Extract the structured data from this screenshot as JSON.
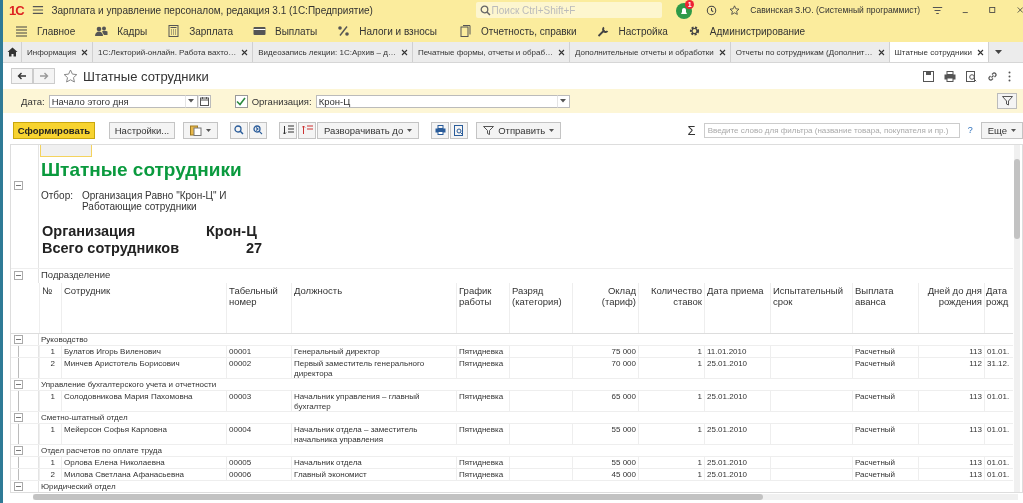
{
  "app": {
    "logo": "1С",
    "title": "Зарплата и управление персоналом, редакция 3.1  (1С:Предприятие)",
    "search": {
      "placeholder": "Поиск Ctrl+Shift+F"
    },
    "notifications": "1",
    "user": "Савинская З.Ю. (Системный программист)"
  },
  "sections": [
    {
      "label": "Главное",
      "kind": "list"
    },
    {
      "label": "Кадры",
      "kind": "people"
    },
    {
      "label": "Зарплата",
      "kind": "calculator"
    },
    {
      "label": "Выплаты",
      "kind": "card"
    },
    {
      "label": "Налоги и взносы",
      "kind": "percent"
    },
    {
      "label": "Отчетность, справки",
      "kind": "docs"
    },
    {
      "label": "Настройка",
      "kind": "wrench"
    },
    {
      "label": "Администрирование",
      "kind": "gear"
    }
  ],
  "tabs": [
    {
      "label": "Информация",
      "selected": false
    },
    {
      "label": "1С:Лекторий-онлайн. Работа вахто…",
      "selected": false
    },
    {
      "label": "Видеозапись лекции: 1С:Архив – д…",
      "selected": false
    },
    {
      "label": "Печатные формы, отчеты и обраб…",
      "selected": false
    },
    {
      "label": "Дополнительные отчеты и обработки",
      "selected": false
    },
    {
      "label": "Отчеты по сотрудникам (Дополнит…",
      "selected": false
    },
    {
      "label": "Штатные сотрудники",
      "selected": true
    }
  ],
  "form": {
    "title": "Штатные сотрудники"
  },
  "filters": {
    "date_label": "Дата:",
    "date_value": "Начало этого дня",
    "org_checked": true,
    "org_label": "Организация:",
    "org_value": "Крон-Ц"
  },
  "toolbar": {
    "generate": "Сформировать",
    "settings": "Настройки...",
    "expand": "Разворачивать до",
    "send": "Отправить",
    "sigma": "Σ",
    "filter_placeholder": "Введите слово для фильтра (название товара, покупателя и пр.)",
    "help": "?",
    "more": "Еще"
  },
  "report": {
    "title": "Штатные сотрудники",
    "filter_label": "Отбор:",
    "filter_text": "Организация Равно \"Крон-Ц\" И Работающие сотрудники",
    "summary": [
      {
        "label": "Организация",
        "value": "Крон-Ц"
      },
      {
        "label": "Всего сотрудников",
        "value": "27"
      }
    ],
    "group_heading": "Подразделение",
    "columns": [
      "№",
      "Сотрудник",
      "Табельный номер",
      "Должность",
      "График работы",
      "Разряд (категория)",
      "Оклад (тариф)",
      "Количество ставок",
      "Дата приема",
      "Испытательный срок",
      "Выплата аванса",
      "Дней до дня рождения",
      "Дата рожд"
    ],
    "groups": [
      {
        "name": "Руководство",
        "expanded": true,
        "rows": [
          {
            "num": "1",
            "name": "Булатов Игорь Виленович",
            "tab_no": "00001",
            "position": "Генеральный директор",
            "schedule": "Пятидневка",
            "salary": "75 000",
            "rate": "1",
            "hired": "11.01.2010",
            "advance": "Расчетный",
            "days": "113",
            "birth": "01.01."
          },
          {
            "num": "2",
            "name": "Минчев Аристотель Борисович",
            "tab_no": "00002",
            "position": "Первый заместитель генерального директора",
            "schedule": "Пятидневка",
            "salary": "70 000",
            "rate": "1",
            "hired": "25.01.2010",
            "advance": "Расчетный",
            "days": "112",
            "birth": "31.12."
          }
        ]
      },
      {
        "name": "Управление бухгалтерского учета и отчетности",
        "expanded": true,
        "rows": [
          {
            "num": "1",
            "name": "Солодовникова Мария Пахомовна",
            "tab_no": "00003",
            "position": "Начальник управления – главный бухгалтер",
            "schedule": "Пятидневка",
            "salary": "65 000",
            "rate": "1",
            "hired": "25.01.2010",
            "advance": "Расчетный",
            "days": "113",
            "birth": "01.01."
          }
        ]
      },
      {
        "name": "Сметно-штатный отдел",
        "expanded": true,
        "rows": [
          {
            "num": "1",
            "name": "Мейерсон Софья Карловна",
            "tab_no": "00004",
            "position": "Начальник отдела – заместитель начальника управления",
            "schedule": "Пятидневка",
            "salary": "55 000",
            "rate": "1",
            "hired": "25.01.2010",
            "advance": "Расчетный",
            "days": "113",
            "birth": "01.01."
          }
        ]
      },
      {
        "name": "Отдел расчетов по оплате труда",
        "expanded": true,
        "rows": [
          {
            "num": "1",
            "name": "Орлова Елена Николаевна",
            "tab_no": "00005",
            "position": "Начальник отдела",
            "schedule": "Пятидневка",
            "salary": "55 000",
            "rate": "1",
            "hired": "25.01.2010",
            "advance": "Расчетный",
            "days": "113",
            "birth": "01.01."
          },
          {
            "num": "2",
            "name": "Милова Светлана Афанасьевна",
            "tab_no": "00006",
            "position": "Главный экономист",
            "schedule": "Пятидневка",
            "salary": "45 000",
            "rate": "1",
            "hired": "25.01.2010",
            "advance": "Расчетный",
            "days": "113",
            "birth": "01.01."
          }
        ]
      },
      {
        "name": "Юридический отдел",
        "expanded": true
      }
    ]
  }
}
